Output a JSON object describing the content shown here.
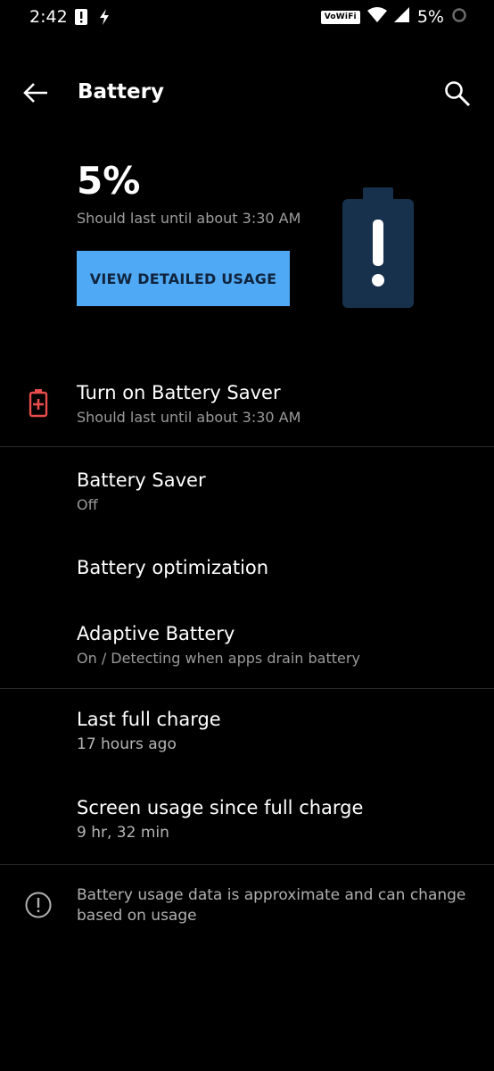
{
  "status_bar": {
    "time": "2:42",
    "left_icons": [
      "alert-icon",
      "flash-icon"
    ],
    "vowifi": "VoWiFi",
    "battery_percent": "5%"
  },
  "app_bar": {
    "title": "Battery"
  },
  "header": {
    "percent": "5%",
    "estimate": "Should last until about 3:30 AM",
    "button_label": "VIEW DETAILED USAGE",
    "graphic_color": "#17314d",
    "button_color": "#4fa9f5"
  },
  "saver_suggestion": {
    "title": "Turn on Battery Saver",
    "subtitle": "Should last until about 3:30 AM",
    "icon_color": "#e84c4c"
  },
  "settings": [
    {
      "title": "Battery Saver",
      "subtitle": "Off"
    },
    {
      "title": "Battery optimization",
      "subtitle": ""
    },
    {
      "title": "Adaptive Battery",
      "subtitle": "On / Detecting when apps drain battery"
    }
  ],
  "usage": [
    {
      "title": "Last full charge",
      "subtitle": "17 hours ago"
    },
    {
      "title": "Screen usage since full charge",
      "subtitle": "9 hr, 32 min"
    }
  ],
  "footer": {
    "text": "Battery usage data is approximate and can change based on usage"
  }
}
